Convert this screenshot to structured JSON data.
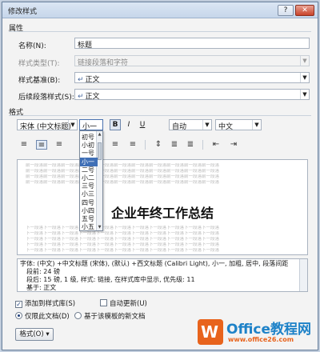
{
  "window": {
    "title": "修改样式",
    "help_label": "?",
    "close_label": "✕"
  },
  "properties": {
    "group_label": "属性",
    "name_label": "名称(N):",
    "name_value": "标题",
    "type_label": "样式类型(T):",
    "type_value": "链接段落和字符",
    "based_on_label": "样式基准(B):",
    "based_on_value": "正文",
    "following_label": "后续段落样式(S):",
    "following_value": "正文"
  },
  "formatting": {
    "group_label": "格式",
    "font_value": "宋体 (中文标题)",
    "size_value": "小一",
    "bold_label": "B",
    "italic_label": "I",
    "underline_label": "U",
    "color_value": "自动",
    "script_value": "中文"
  },
  "size_options": [
    {
      "label": "初号",
      "selected": false
    },
    {
      "label": "小初",
      "selected": false
    },
    {
      "label": "一号",
      "selected": false
    },
    {
      "label": "小一",
      "selected": true
    },
    {
      "label": "二号",
      "selected": false
    },
    {
      "label": "小二",
      "selected": false
    },
    {
      "label": "三号",
      "selected": false
    },
    {
      "label": "小三",
      "selected": false
    },
    {
      "label": "四号",
      "selected": false
    },
    {
      "label": "小四",
      "selected": false
    },
    {
      "label": "五号",
      "selected": false
    },
    {
      "label": "小五",
      "selected": false
    }
  ],
  "preview": {
    "ghost_before": "前一段落前一段落前一段落前一段落前一段落前一段落前一段落前一段落前一段落前一段落前一段落",
    "ghost_after": "下一段落下一段落下一段落下一段落下一段落下一段落下一段落下一段落下一段落下一段落下一段落",
    "sample_text": "企业年终工作总结"
  },
  "description": {
    "line1": "字体: (中文) +中文标题 (宋体), (默认) +西文标题 (Calibri Light), 小一, 加粗, 居中, 段落间距",
    "line2": "段前: 24 磅",
    "line3": "段后: 15 磅, 1 级, 样式: 链接, 在样式库中显示, 优先级: 11",
    "line4": "基于: 正文"
  },
  "options": {
    "add_to_gallery_label": "添加到样式库(S)",
    "add_to_gallery_checked": true,
    "auto_update_label": "自动更新(U)",
    "auto_update_checked": false,
    "only_this_doc_label": "仅限此文档(D)",
    "only_this_doc_selected": true,
    "new_docs_label": "基于该模板的新文档",
    "new_docs_selected": false
  },
  "footer": {
    "format_button_label": "格式(O) ▾"
  },
  "watermark": {
    "main_text": "Office教程网",
    "sub_text": "www.office26.com"
  }
}
